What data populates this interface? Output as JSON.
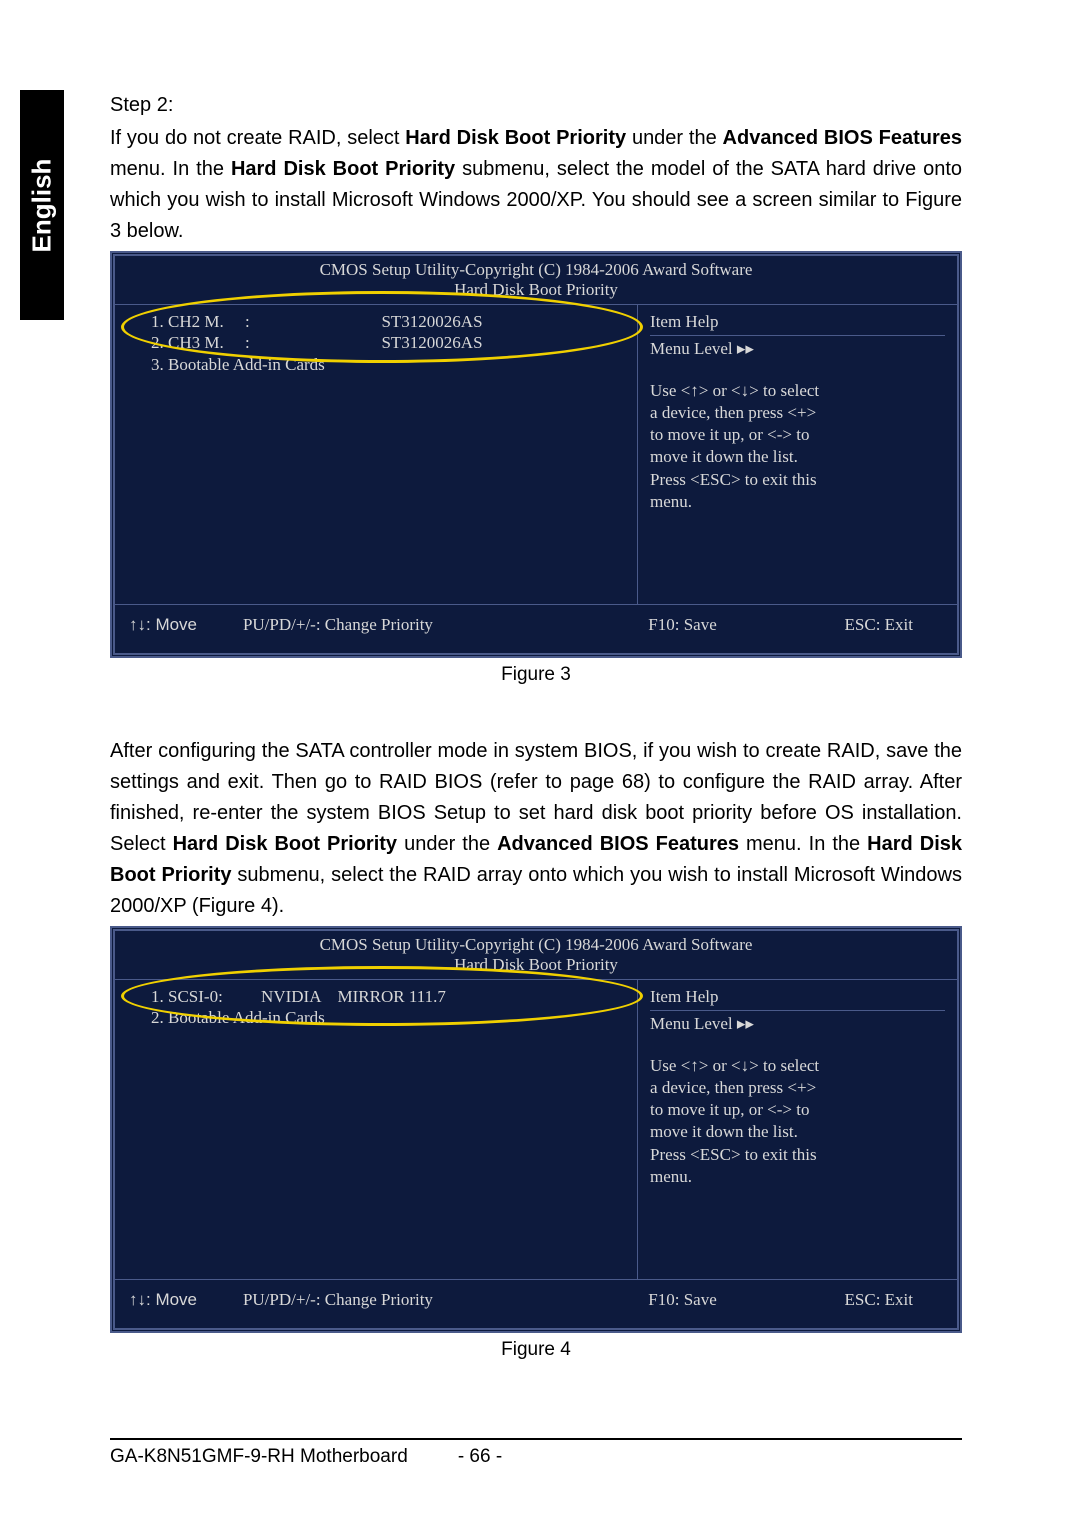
{
  "lang_tab": "English",
  "step_label": "Step 2:",
  "para1_a": "If you do not create RAID, select ",
  "para1_bold1": "Hard Disk Boot Priority",
  "para1_b": " under the ",
  "para1_bold2": "Advanced BIOS Features",
  "para1_c": " menu. In the ",
  "para1_bold3": "Hard Disk Boot Priority",
  "para1_d": " submenu, select the model of the SATA hard drive onto which you wish to install Microsoft Windows 2000/XP. You should see a screen similar to Figure 3 below.",
  "bios_title": "CMOS Setup Utility-Copyright (C) 1984-2006 Award Software",
  "bios_subtitle": "Hard Disk Boot Priority",
  "fig3_row1": "1. CH2 M.     :                               ST3120026AS",
  "fig3_row2": "2. CH3 M.     :                               ST3120026AS",
  "fig3_row3": "3. Bootable Add-in Cards",
  "help_title": "Item Help",
  "menu_level": "Menu Level     ▸▸",
  "help_text": "Use <↑>    or <↓> to select a device, then press <+> to move it up, or <-> to move it down the list. Press <ESC> to exit this menu.",
  "footer_move": "↑↓: Move",
  "footer_change": "PU/PD/+/-: Change Priority",
  "footer_save": "F10: Save",
  "footer_exit": "ESC: Exit",
  "caption3": "Figure 3",
  "para2_a": "After configuring the SATA controller mode in system BIOS, if you wish to create RAID, save the settings and exit. Then go to RAID BIOS (refer to page 68) to configure the RAID array. After finished, re-enter the system BIOS Setup to set hard disk boot priority before OS installation. Select ",
  "para2_bold1": "Hard Disk Boot Priority",
  "para2_b": " under the ",
  "para2_bold2": "Advanced BIOS Features",
  "para2_c": " menu. In the ",
  "para2_bold3": "Hard Disk Boot Priority",
  "para2_d": " submenu, select the RAID array onto which you wish to install Microsoft Windows 2000/XP (Figure 4).",
  "fig4_row1": "1. SCSI-0:         NVIDIA    MIRROR 111.7",
  "fig4_row2": "2. Bootable Add-in Cards",
  "caption4": "Figure 4",
  "footer_model": "GA-K8N51GMF-9-RH Motherboard",
  "footer_page": "- 66 -"
}
